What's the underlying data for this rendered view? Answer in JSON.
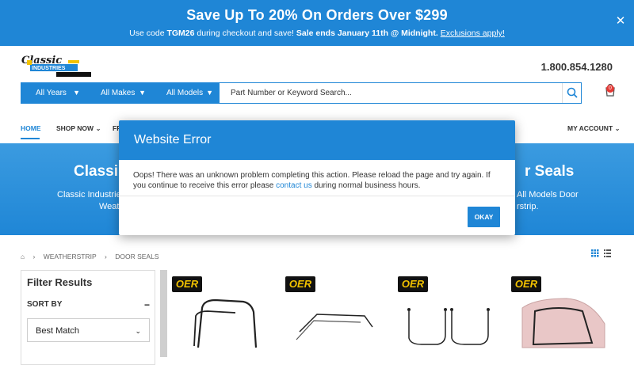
{
  "banner": {
    "headline": "Save Up To 20% On Orders Over $299",
    "sub_prefix": "Use code ",
    "code": "TGM26",
    "sub_mid": " during checkout and save! ",
    "sale_ends": "Sale ends January 11th @ Midnight.",
    "exclusions": "Exclusions apply!",
    "close_icon": "close-icon"
  },
  "header": {
    "phone": "1.800.854.1280",
    "cart_count": "0",
    "search": {
      "years": "All Years",
      "makes": "All Makes",
      "models": "All Models",
      "placeholder": "Part Number or Keyword Search..."
    }
  },
  "nav": {
    "home": "HOME",
    "shop_now": "SHOP NOW",
    "partial": "FR",
    "account": "MY ACCOUNT"
  },
  "hero": {
    "title_left": "Classi",
    "title_right": "r Seals",
    "line1_left": "Classic Industrie",
    "line2_left": "Weat",
    "line1_right": "All Models Door",
    "line2_right": "rstrip."
  },
  "breadcrumb": {
    "items": [
      "WEATHERSTRIP",
      "DOOR SEALS"
    ]
  },
  "filter": {
    "title": "Filter Results",
    "sort_label": "SORT BY",
    "sort_value": "Best Match"
  },
  "products": [
    {
      "brand": "OER"
    },
    {
      "brand": "OER"
    },
    {
      "brand": "OER"
    },
    {
      "brand": "OER"
    }
  ],
  "modal": {
    "title": "Website Error",
    "message_1": "Oops! There was an unknown problem completing this action. Please reload the page and try again. If you continue to receive this error please ",
    "link": "contact us",
    "message_2": " during normal business hours.",
    "button": "OKAY"
  },
  "colors": {
    "brand_blue": "#1f86d6",
    "badge_red": "#e53935",
    "oer_yellow": "#f2c200"
  }
}
